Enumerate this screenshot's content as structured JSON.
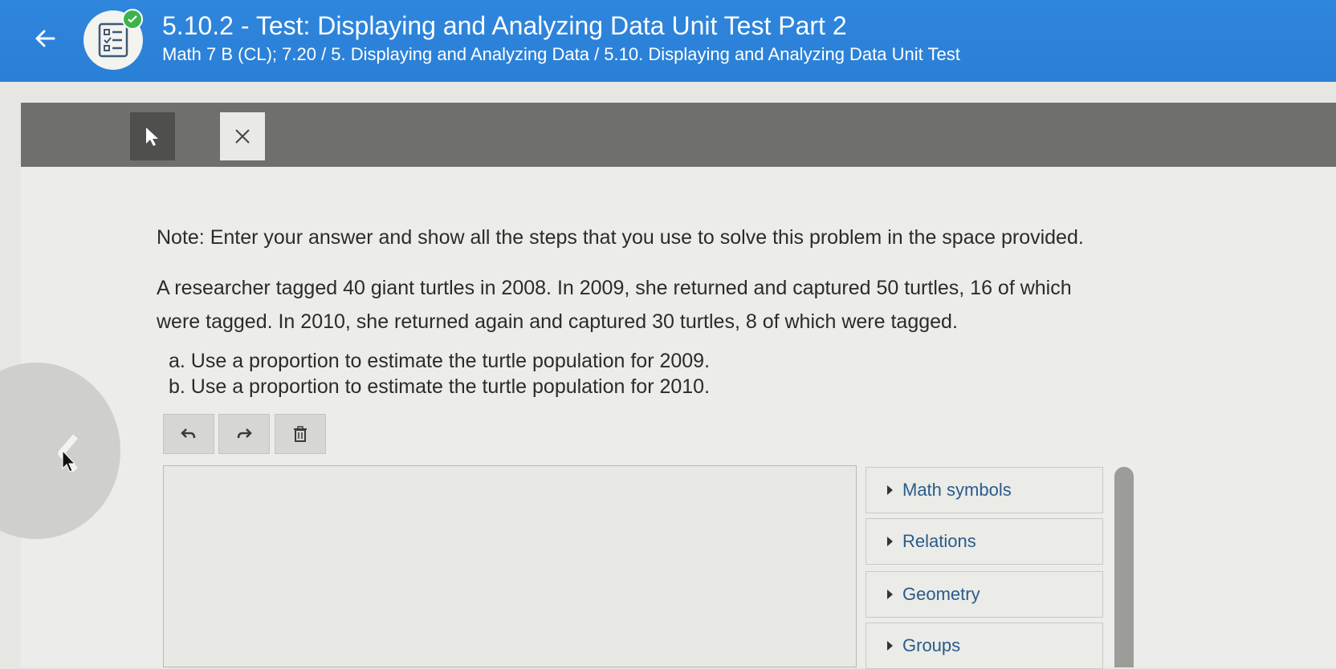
{
  "header": {
    "title": "5.10.2 - Test: Displaying and Analyzing Data Unit Test Part 2",
    "subtitle": "Math 7 B (CL); 7.20 / 5. Displaying and Analyzing Data / 5.10. Displaying and Analyzing Data Unit Test"
  },
  "question": {
    "note": "Note: Enter your answer and show all the steps that you use to solve this problem in the space provided.",
    "problem": "A researcher tagged 40 giant turtles in 2008. In 2009, she returned and captured 50 turtles, 16 of which were tagged. In 2010, she returned again and captured 30 turtles, 8 of which were tagged.",
    "parts": [
      "a. Use a proportion to estimate the turtle population for 2009.",
      "b. Use a proportion to estimate the turtle population for 2010."
    ]
  },
  "palette": {
    "items": [
      "Math symbols",
      "Relations",
      "Geometry",
      "Groups"
    ]
  },
  "colors": {
    "header_bg": "#2f86dd",
    "palette_label": "#2a5b8a",
    "toolbar_bg": "#6f6f6d"
  }
}
